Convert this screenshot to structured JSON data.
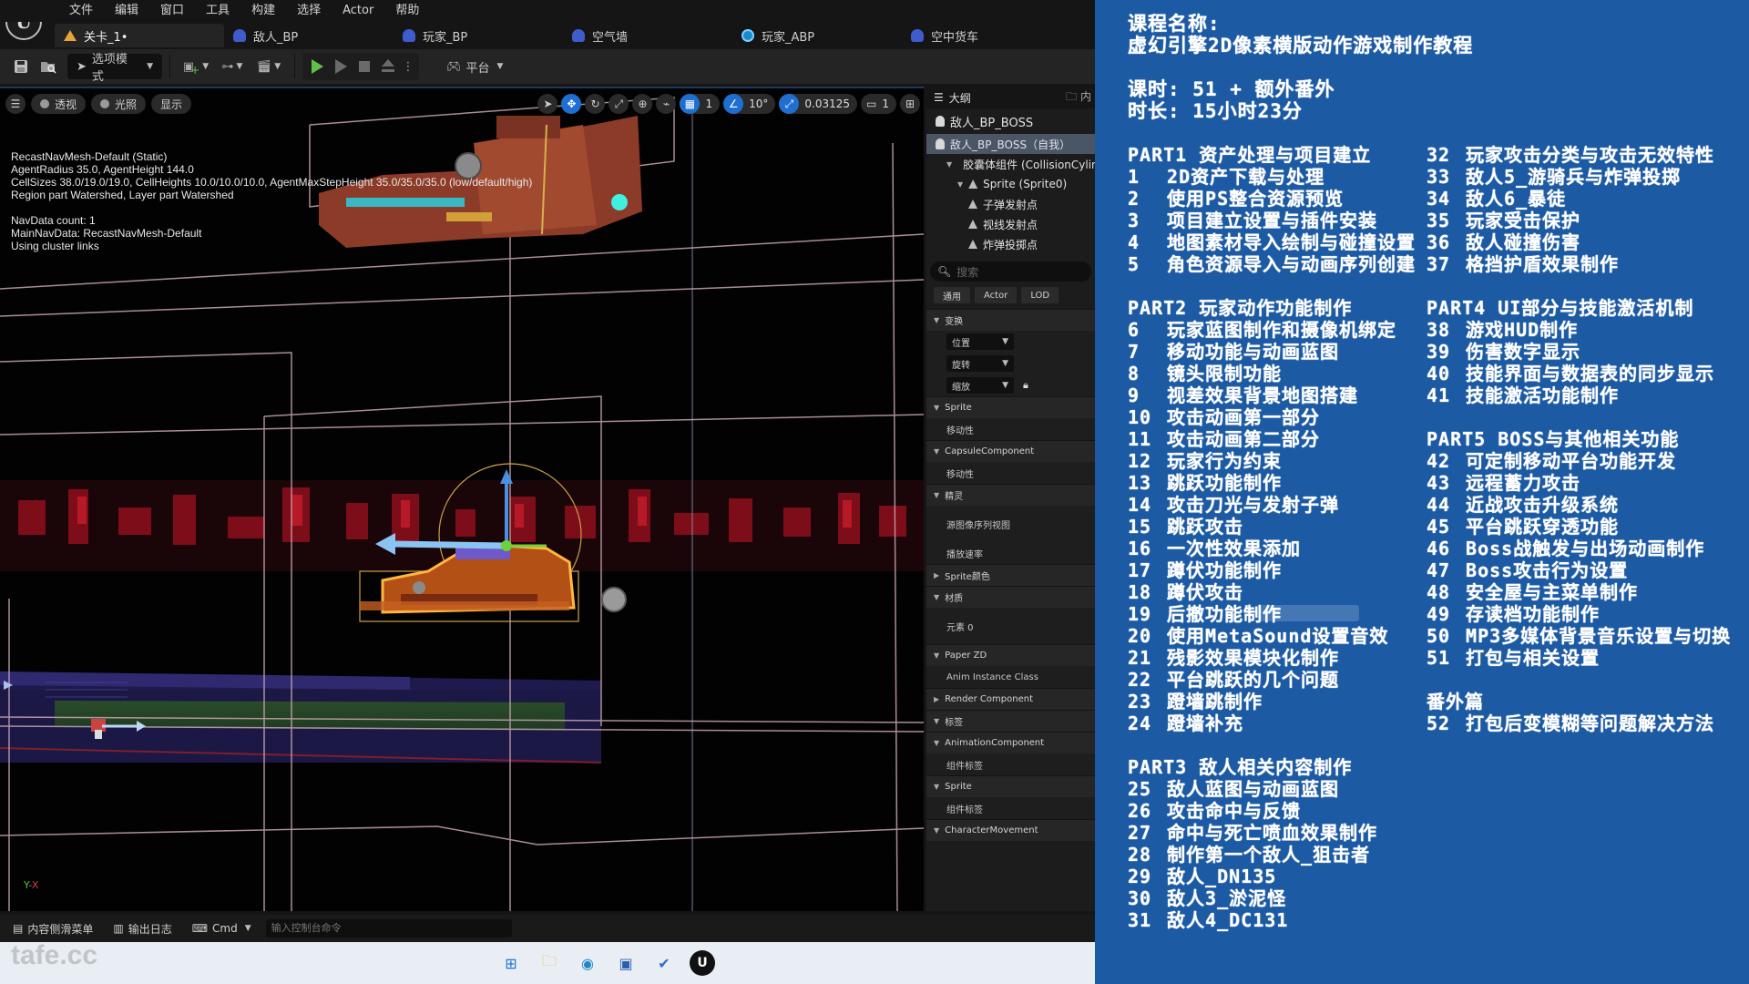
{
  "editor": {
    "menu": [
      "文件",
      "编辑",
      "窗口",
      "工具",
      "构建",
      "选择",
      "Actor",
      "帮助"
    ],
    "tabs": [
      {
        "label": "关卡_1•",
        "icon": "level-icon",
        "active": true
      },
      {
        "label": "敌人_BP",
        "icon": "blueprint-icon"
      },
      {
        "label": "玩家_BP",
        "icon": "blueprint-icon"
      },
      {
        "label": "空气墙",
        "icon": "blueprint-icon"
      },
      {
        "label": "玩家_ABP",
        "icon": "anim-blueprint-icon"
      },
      {
        "label": "空中货车",
        "icon": "blueprint-icon"
      }
    ],
    "toolbar": {
      "mode_label": "选项模式",
      "platform_label": "平台"
    },
    "viewport": {
      "view_buttons": [
        "透视",
        "光照",
        "显示"
      ],
      "grid_snap": "1",
      "rotation_snap": "10°",
      "scale_snap": "0.03125",
      "camera_speed": "1",
      "navmesh_info": [
        "RecastNavMesh-Default (Static)",
        "AgentRadius 35.0, AgentHeight 144.0",
        "CellSizes 38.0/19.0/19.0, CellHeights 10.0/10.0/10.0, AgentMaxStepHeight 35.0/35.0/35.0 (low/default/high)",
        "Region part Watershed, Layer part Watershed"
      ],
      "navdata_info": [
        "NavData count: 1",
        "MainNavData: RecastNavMesh-Default",
        "Using cluster links"
      ]
    },
    "outliner": {
      "title": "大纲",
      "content_tab": "内",
      "root": "敌人_BP_BOSS",
      "items": [
        {
          "label": "敌人_BP_BOSS（自我）",
          "level": 0,
          "selected": true
        },
        {
          "label": "胶囊体组件 (CollisionCylinder)",
          "level": 1
        },
        {
          "label": "Sprite (Sprite0)",
          "level": 2
        },
        {
          "label": "子弹发射点",
          "level": 3
        },
        {
          "label": "视线发射点",
          "level": 3
        },
        {
          "label": "炸弹投掷点",
          "level": 3
        }
      ]
    },
    "details": {
      "search_placeholder": "搜索",
      "filters": [
        "通用",
        "Actor",
        "LOD"
      ],
      "sections": [
        {
          "label": "变换",
          "expanded": true,
          "rows": [
            {
              "dropdown": "位置"
            },
            {
              "dropdown": "旋转"
            },
            {
              "dropdown": "缩放",
              "lock": true
            }
          ]
        },
        {
          "label": "Sprite",
          "expanded": true,
          "rows": [
            {
              "label": "移动性"
            }
          ]
        },
        {
          "label": "CapsuleComponent",
          "expanded": true,
          "rows": [
            {
              "label": "移动性"
            }
          ]
        },
        {
          "label": "精灵",
          "expanded": true,
          "rows": [
            {
              "label": "源图像序列视图",
              "tall": true
            },
            {
              "label": "播放速率"
            }
          ]
        },
        {
          "label": "Sprite颜色",
          "expanded": false,
          "rows": []
        },
        {
          "label": "材质",
          "expanded": true,
          "rows": [
            {
              "label": "元素 0",
              "tall": true
            }
          ]
        },
        {
          "label": "Paper ZD",
          "expanded": true,
          "rows": [
            {
              "label": "Anim Instance Class"
            }
          ]
        },
        {
          "label": "Render Component",
          "expanded": false,
          "rows": []
        },
        {
          "label": "标签",
          "expanded": true,
          "rows": []
        },
        {
          "label": "AnimationComponent",
          "expanded": true,
          "rows": [
            {
              "label": "组件标签"
            }
          ]
        },
        {
          "label": "Sprite",
          "expanded": true,
          "rows": [
            {
              "label": "组件标签"
            }
          ]
        },
        {
          "label": "CharacterMovement",
          "expanded": true,
          "rows": []
        }
      ]
    },
    "statusbar": {
      "content_drawer": "内容侧滑菜单",
      "output_log": "输出日志",
      "cmd_label": "Cmd",
      "cmd_placeholder": "输入控制台命令"
    },
    "watermark": "tafe.cc"
  },
  "course": {
    "title_label": "课程名称:",
    "title": "虚幻引擎2D像素横版动作游戏制作教程",
    "lessons_line": "课时: 51 + 额外番外",
    "duration_line": "时长: 15小时23分",
    "left_column": [
      {
        "type": "part",
        "text": "PART1 资产处理与项目建立"
      },
      {
        "num": "1",
        "text": "2D资产下载与处理"
      },
      {
        "num": "2",
        "text": "使用PS整合资源预览"
      },
      {
        "num": "3",
        "text": "项目建立设置与插件安装"
      },
      {
        "num": "4",
        "text": "地图素材导入绘制与碰撞设置"
      },
      {
        "num": "5",
        "text": "角色资源导入与动画序列创建"
      },
      {
        "type": "gap"
      },
      {
        "type": "part",
        "text": "PART2 玩家动作功能制作"
      },
      {
        "num": "6",
        "text": "玩家蓝图制作和摄像机绑定"
      },
      {
        "num": "7",
        "text": "移动功能与动画蓝图"
      },
      {
        "num": "8",
        "text": "镜头限制功能"
      },
      {
        "num": "9",
        "text": "视差效果背景地图搭建"
      },
      {
        "num": "10",
        "text": "攻击动画第一部分"
      },
      {
        "num": "11",
        "text": "攻击动画第二部分"
      },
      {
        "num": "12",
        "text": "玩家行为约束"
      },
      {
        "num": "13",
        "text": "跳跃功能制作"
      },
      {
        "num": "14",
        "text": "攻击刀光与发射子弹"
      },
      {
        "num": "15",
        "text": "跳跃攻击"
      },
      {
        "num": "16",
        "text": "一次性效果添加"
      },
      {
        "num": "17",
        "text": "蹲伏功能制作"
      },
      {
        "num": "18",
        "text": "蹲伏攻击"
      },
      {
        "num": "19",
        "text": "后撤功能制作"
      },
      {
        "num": "20",
        "text": "使用MetaSound设置音效"
      },
      {
        "num": "21",
        "text": "残影效果模块化制作"
      },
      {
        "num": "22",
        "text": "平台跳跃的几个问题"
      },
      {
        "num": "23",
        "text": "蹬墙跳制作"
      },
      {
        "num": "24",
        "text": "蹬墙补充"
      },
      {
        "type": "gap"
      },
      {
        "type": "part",
        "text": "PART3 敌人相关内容制作"
      },
      {
        "num": "25",
        "text": "敌人蓝图与动画蓝图"
      },
      {
        "num": "26",
        "text": "攻击命中与反馈"
      },
      {
        "num": "27",
        "text": "命中与死亡喷血效果制作"
      },
      {
        "num": "28",
        "text": "制作第一个敌人_狙击者"
      },
      {
        "num": "29",
        "text": "敌人_DN135"
      },
      {
        "num": "30",
        "text": "敌人3_淤泥怪"
      },
      {
        "num": "31",
        "text": "敌人4_DC131"
      }
    ],
    "right_column": [
      {
        "num": "32",
        "text": "玩家攻击分类与攻击无效特性"
      },
      {
        "num": "33",
        "text": "敌人5_游骑兵与炸弹投掷"
      },
      {
        "num": "34",
        "text": "敌人6_暴徒"
      },
      {
        "num": "35",
        "text": "玩家受击保护"
      },
      {
        "num": "36",
        "text": "敌人碰撞伤害"
      },
      {
        "num": "37",
        "text": "格挡护盾效果制作"
      },
      {
        "type": "gap"
      },
      {
        "type": "part",
        "text": "PART4 UI部分与技能激活机制"
      },
      {
        "num": "38",
        "text": "游戏HUD制作"
      },
      {
        "num": "39",
        "text": "伤害数字显示"
      },
      {
        "num": "40",
        "text": "技能界面与数据表的同步显示"
      },
      {
        "num": "41",
        "text": "技能激活功能制作"
      },
      {
        "type": "gap"
      },
      {
        "type": "part",
        "text": "PART5 BOSS与其他相关功能"
      },
      {
        "num": "42",
        "text": "可定制移动平台功能开发"
      },
      {
        "num": "43",
        "text": "远程蓄力攻击"
      },
      {
        "num": "44",
        "text": "近战攻击升级系统"
      },
      {
        "num": "45",
        "text": "平台跳跃穿透功能"
      },
      {
        "num": "46",
        "text": "Boss战触发与出场动画制作"
      },
      {
        "num": "47",
        "text": "Boss攻击行为设置"
      },
      {
        "num": "48",
        "text": "安全屋与主菜单制作"
      },
      {
        "num": "49",
        "text": "存读档功能制作"
      },
      {
        "num": "50",
        "text": "MP3多媒体背景音乐设置与切换"
      },
      {
        "num": "51",
        "text": "打包与相关设置"
      },
      {
        "type": "gap"
      },
      {
        "type": "part",
        "text": "番外篇"
      },
      {
        "num": "52",
        "text": "打包后变模糊等问题解决方法"
      }
    ]
  }
}
